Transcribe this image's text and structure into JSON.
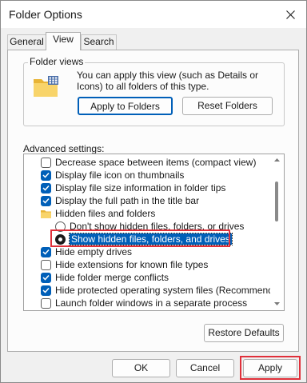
{
  "window": {
    "title": "Folder Options"
  },
  "tabs": [
    {
      "label": "General",
      "active": false
    },
    {
      "label": "View",
      "active": true
    },
    {
      "label": "Search",
      "active": false
    }
  ],
  "folder_views": {
    "group_title": "Folder views",
    "description": "You can apply this view (such as Details or Icons) to all folders of this type.",
    "apply_button": "Apply to Folders",
    "reset_button": "Reset Folders"
  },
  "advanced": {
    "label": "Advanced settings:",
    "items": [
      {
        "type": "checkbox",
        "checked": false,
        "label": "Decrease space between items (compact view)"
      },
      {
        "type": "checkbox",
        "checked": true,
        "label": "Display file icon on thumbnails"
      },
      {
        "type": "checkbox",
        "checked": true,
        "label": "Display file size information in folder tips"
      },
      {
        "type": "checkbox",
        "checked": true,
        "label": "Display the full path in the title bar"
      },
      {
        "type": "folder",
        "label": "Hidden files and folders"
      },
      {
        "type": "radio",
        "checked": false,
        "label": "Don't show hidden files, folders, or drives"
      },
      {
        "type": "radio",
        "checked": true,
        "selected": true,
        "label": "Show hidden files, folders, and drives"
      },
      {
        "type": "checkbox",
        "checked": true,
        "label": "Hide empty drives"
      },
      {
        "type": "checkbox",
        "checked": false,
        "label": "Hide extensions for known file types"
      },
      {
        "type": "checkbox",
        "checked": true,
        "label": "Hide folder merge conflicts"
      },
      {
        "type": "checkbox",
        "checked": true,
        "label": "Hide protected operating system files (Recommended)"
      },
      {
        "type": "checkbox",
        "checked": false,
        "label": "Launch folder windows in a separate process"
      }
    ],
    "restore_button": "Restore Defaults"
  },
  "footer": {
    "ok": "OK",
    "cancel": "Cancel",
    "apply": "Apply"
  },
  "colors": {
    "accent": "#005fb8",
    "highlight_annotation": "#e0303a"
  }
}
